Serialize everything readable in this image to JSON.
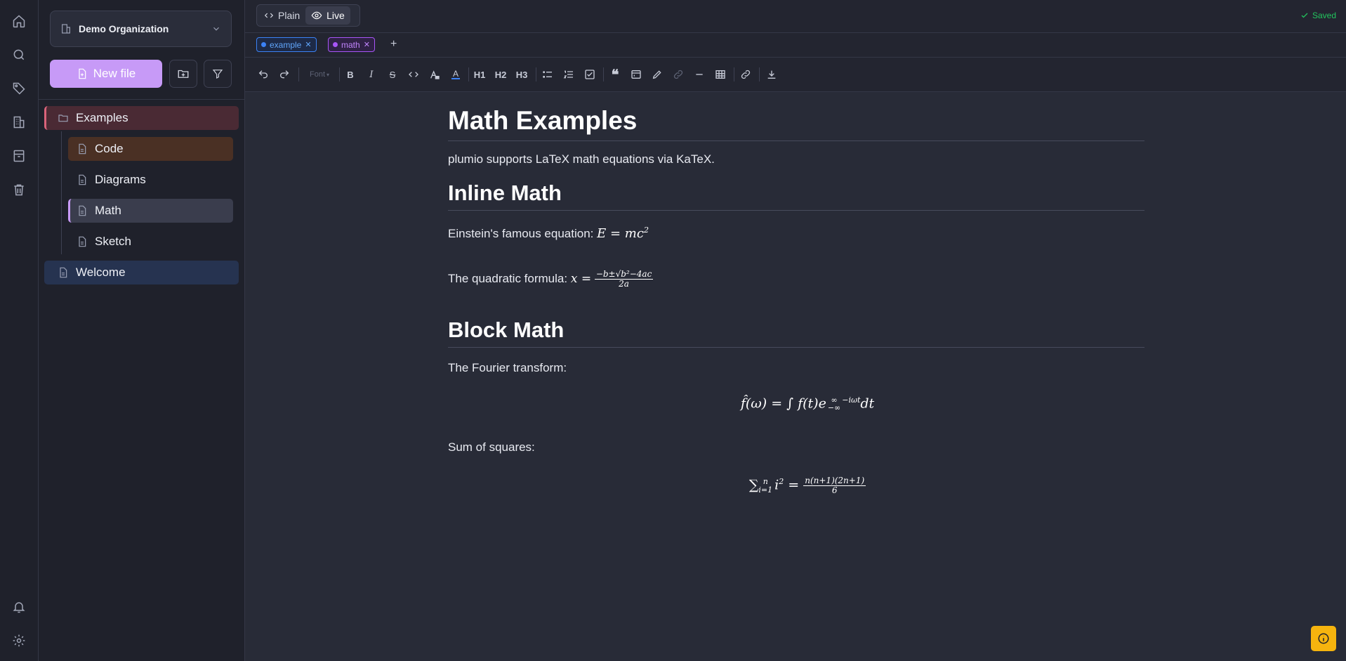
{
  "rail": {
    "icons": [
      "home-icon",
      "search-icon",
      "tag-icon",
      "building-icon",
      "archive-icon",
      "trash-icon"
    ],
    "bottom_icons": [
      "bell-icon",
      "gear-icon"
    ]
  },
  "sidebar": {
    "org_name": "Demo Organization",
    "new_file_label": "New file",
    "tree": [
      {
        "label": "Examples",
        "type": "folder"
      },
      {
        "label": "Code",
        "type": "file"
      },
      {
        "label": "Diagrams",
        "type": "file"
      },
      {
        "label": "Math",
        "type": "file"
      },
      {
        "label": "Sketch",
        "type": "file"
      },
      {
        "label": "Welcome",
        "type": "file"
      }
    ]
  },
  "topbar": {
    "plain_label": "Plain",
    "live_label": "Live",
    "saved_label": "Saved"
  },
  "tags": [
    {
      "label": "example",
      "color": "#3b82f6"
    },
    {
      "label": "math",
      "color": "#a855f7"
    }
  ],
  "toolbar": {
    "font_label": "Font",
    "h1_label": "H1",
    "h2_label": "H2",
    "h3_label": "H3"
  },
  "document": {
    "title": "Math Examples",
    "intro": "plumio supports LaTeX math equations via KaTeX.",
    "inline_heading": "Inline Math",
    "einstein_text": "Einstein's famous equation:",
    "einstein_math": "E = mc",
    "einstein_exp": "2",
    "quadratic_text": "The quadratic formula:",
    "quadratic_lhs": "x =",
    "quadratic_num": "−b±√b²−4ac",
    "quadratic_den": "2a",
    "block_heading": "Block Math",
    "fourier_text": "The Fourier transform:",
    "fourier_math": "f̂(ω) = ∫ f(t)e",
    "fourier_upper": "∞",
    "fourier_lower": "−∞",
    "fourier_exp": "−iωt",
    "fourier_tail": "dt",
    "sum_text": "Sum of squares:",
    "sum_symbol": "∑",
    "sum_upper": "n",
    "sum_lower": "i=1",
    "sum_term": "i",
    "sum_term_exp": "2",
    "sum_eq": "=",
    "sum_num": "n(n+1)(2n+1)",
    "sum_den": "6"
  },
  "colors": {
    "accent": "#c79af7",
    "saved": "#22c55e",
    "help_button": "#f6b40e"
  }
}
